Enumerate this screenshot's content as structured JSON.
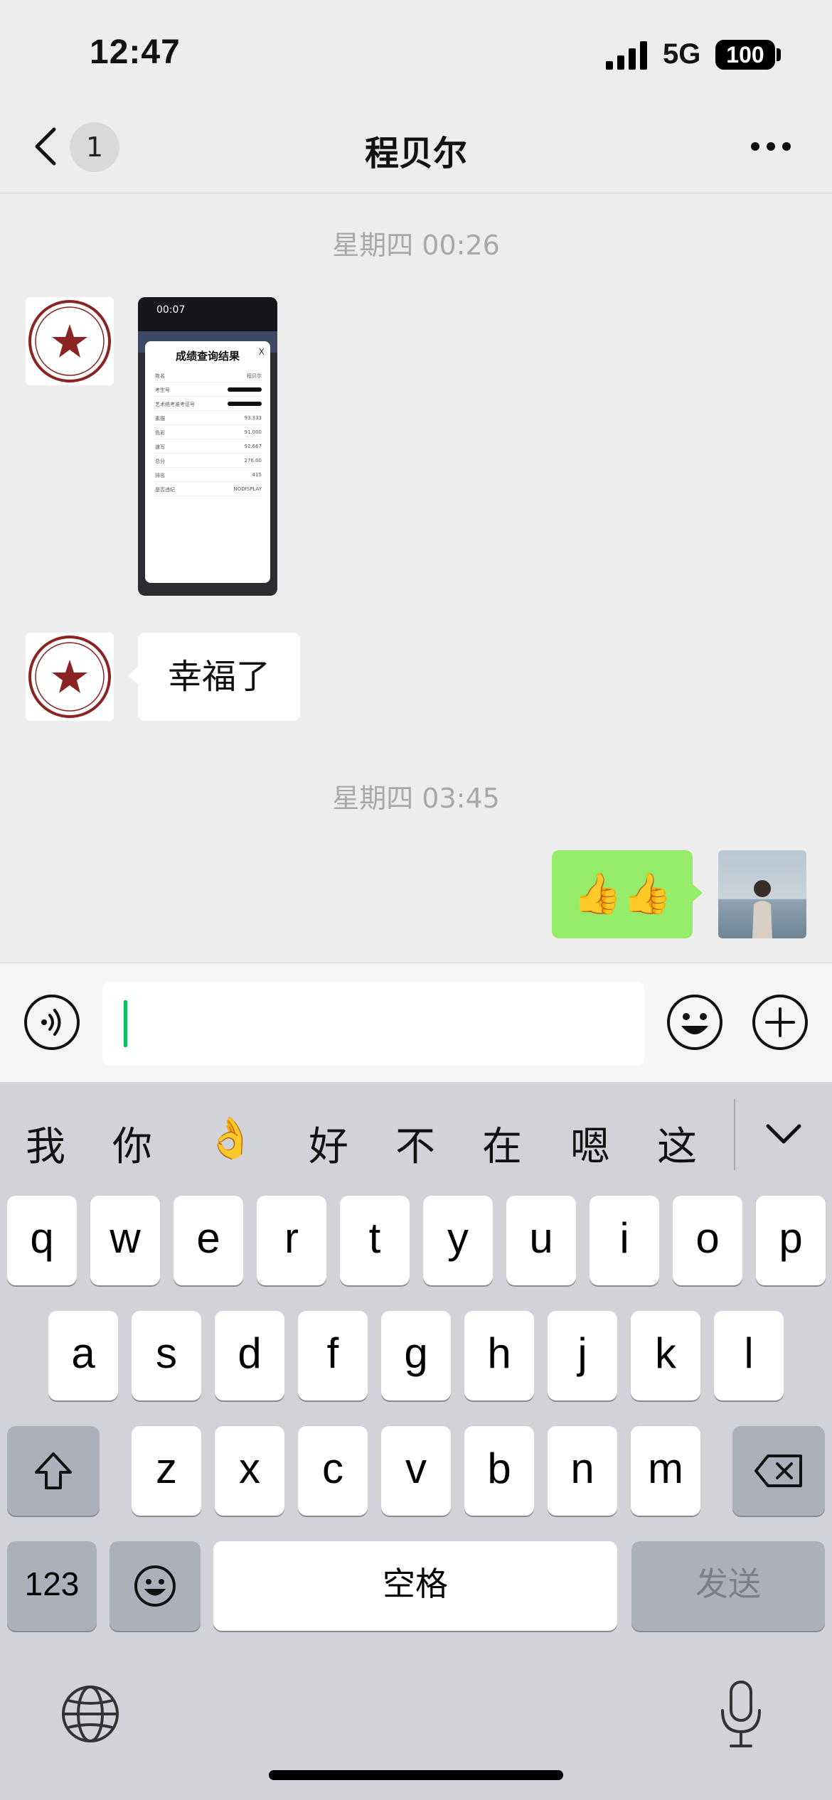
{
  "status_bar": {
    "time": "12:47",
    "network": "5G",
    "battery": "100"
  },
  "nav": {
    "back_label": "back",
    "unread_count": "1",
    "title": "程贝尔",
    "more_icon": "more-icon"
  },
  "messages": {
    "timestamp_1": "星期四 00:26",
    "screenshot": {
      "time": "00:07",
      "card_title": "成绩查询结果",
      "close": "X",
      "rows": [
        {
          "k": "姓名",
          "v": "程贝尔"
        },
        {
          "k": "考生号",
          "v": ""
        },
        {
          "k": "艺术统考准考证号",
          "v": ""
        },
        {
          "k": "素描",
          "v": "93.333"
        },
        {
          "k": "色彩",
          "v": "91.000"
        },
        {
          "k": "速写",
          "v": "92.667"
        },
        {
          "k": "总分",
          "v": "276.00"
        },
        {
          "k": "排名",
          "v": "415"
        },
        {
          "k": "是否违纪",
          "v": "NODISPLAY"
        }
      ]
    },
    "text_received": "幸福了",
    "timestamp_2": "星期四 03:45",
    "text_sent": "👍👍"
  },
  "keyboard": {
    "candidates": [
      "我",
      "你",
      "👌",
      "好",
      "不",
      "在",
      "嗯",
      "这"
    ],
    "row1": [
      "q",
      "w",
      "e",
      "r",
      "t",
      "y",
      "u",
      "i",
      "o",
      "p"
    ],
    "row2": [
      "a",
      "s",
      "d",
      "f",
      "g",
      "h",
      "j",
      "k",
      "l"
    ],
    "row3": [
      "z",
      "x",
      "c",
      "v",
      "b",
      "n",
      "m"
    ],
    "numbers_key": "123",
    "space_key": "空格",
    "send_key": "发送"
  },
  "colors": {
    "sent_bubble": "#95ec69",
    "cursor": "#07c160",
    "background": "#ededed"
  }
}
